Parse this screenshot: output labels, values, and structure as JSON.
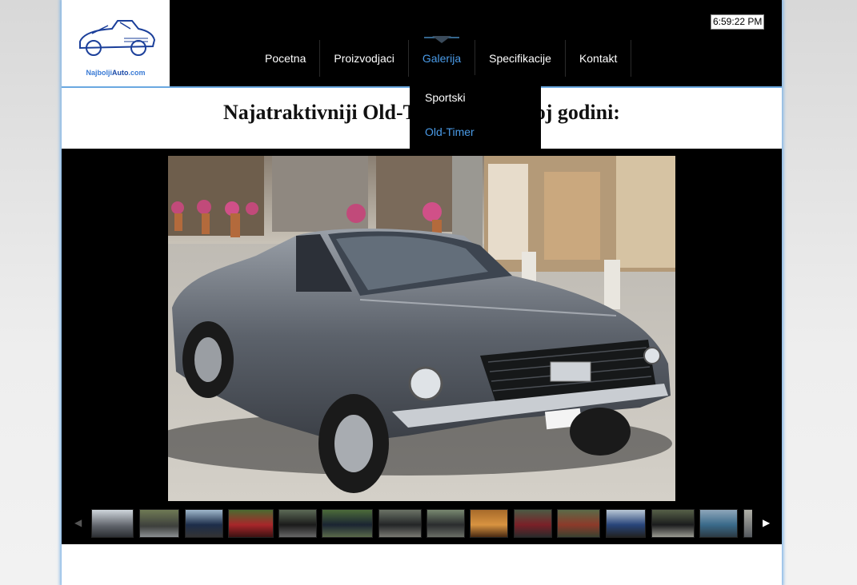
{
  "logo": {
    "text_a": "Najbolji",
    "text_b": "Auto",
    "text_c": ".com"
  },
  "clock": "6:59:22 PM",
  "nav": {
    "items": [
      {
        "label": "Pocetna"
      },
      {
        "label": "Proizvodjaci"
      },
      {
        "label": "Galerija"
      },
      {
        "label": "Specifikacije"
      },
      {
        "label": "Kontakt"
      }
    ],
    "active_index": 2
  },
  "dropdown": {
    "items": [
      {
        "label": "Sportski"
      },
      {
        "label": "Old-Timer"
      }
    ],
    "active_index": 1
  },
  "page_title": "Najatraktivniji Old-Timer u 2013-toj godini:",
  "gallery": {
    "thumbnail_count": 15,
    "prev_icon": "left-triangle",
    "next_icon": "right-triangle"
  },
  "colors": {
    "accent": "#4a9be8",
    "header_bg": "#000000",
    "border_glow": "#7fb4e6"
  }
}
